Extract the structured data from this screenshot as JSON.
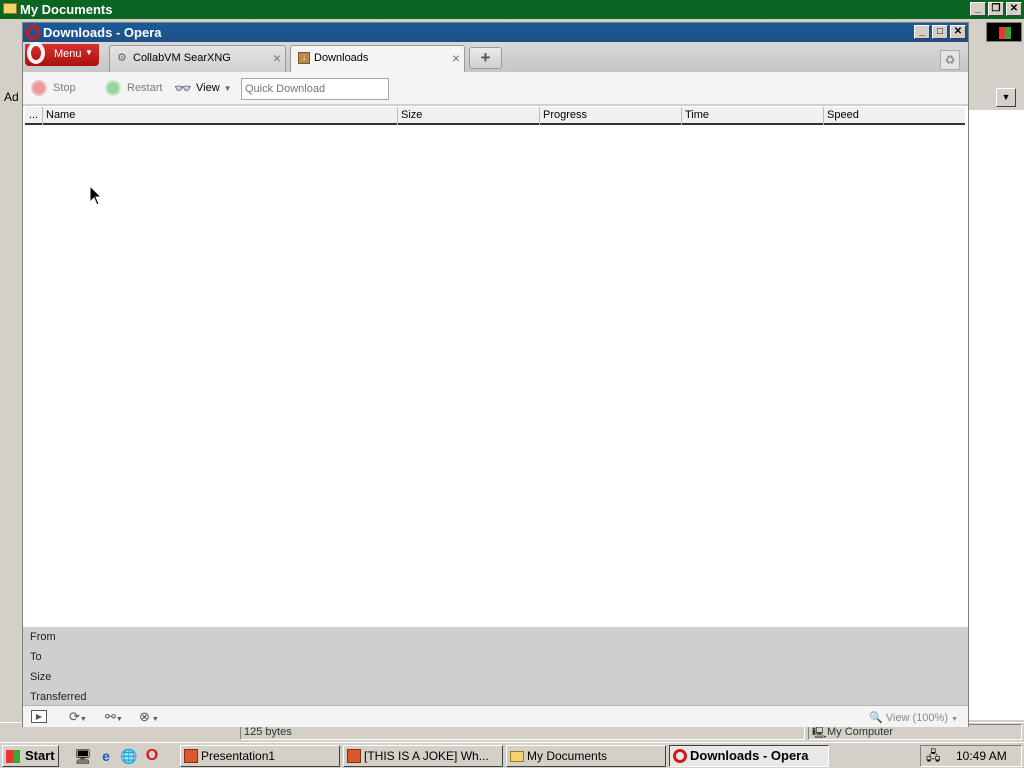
{
  "bg_window": {
    "title": "My Documents",
    "address_label": "Ad",
    "status_size": "125 bytes",
    "status_zone": "My Computer"
  },
  "opera": {
    "title": "Downloads - Opera",
    "menu_label": "Menu",
    "tabs": [
      {
        "label": "CollabVM SearXNG",
        "icon": "globe-icon"
      },
      {
        "label": "Downloads",
        "icon": "download-icon"
      }
    ],
    "toolbar": {
      "stop": "Stop",
      "restart": "Restart",
      "view": "View",
      "quick_download_placeholder": "Quick Download"
    },
    "columns": [
      "...",
      "Name",
      "Size",
      "Progress",
      "Time",
      "Speed"
    ],
    "details": {
      "from": "From",
      "to": "To",
      "size": "Size",
      "transferred": "Transferred"
    },
    "zoom": "View (100%)"
  },
  "taskbar": {
    "start": "Start",
    "tasks": [
      {
        "label": "Presentation1"
      },
      {
        "label": "[THIS IS A JOKE] Wh..."
      },
      {
        "label": "My Documents"
      },
      {
        "label": "Downloads - Opera"
      }
    ],
    "clock": "10:49 AM"
  }
}
